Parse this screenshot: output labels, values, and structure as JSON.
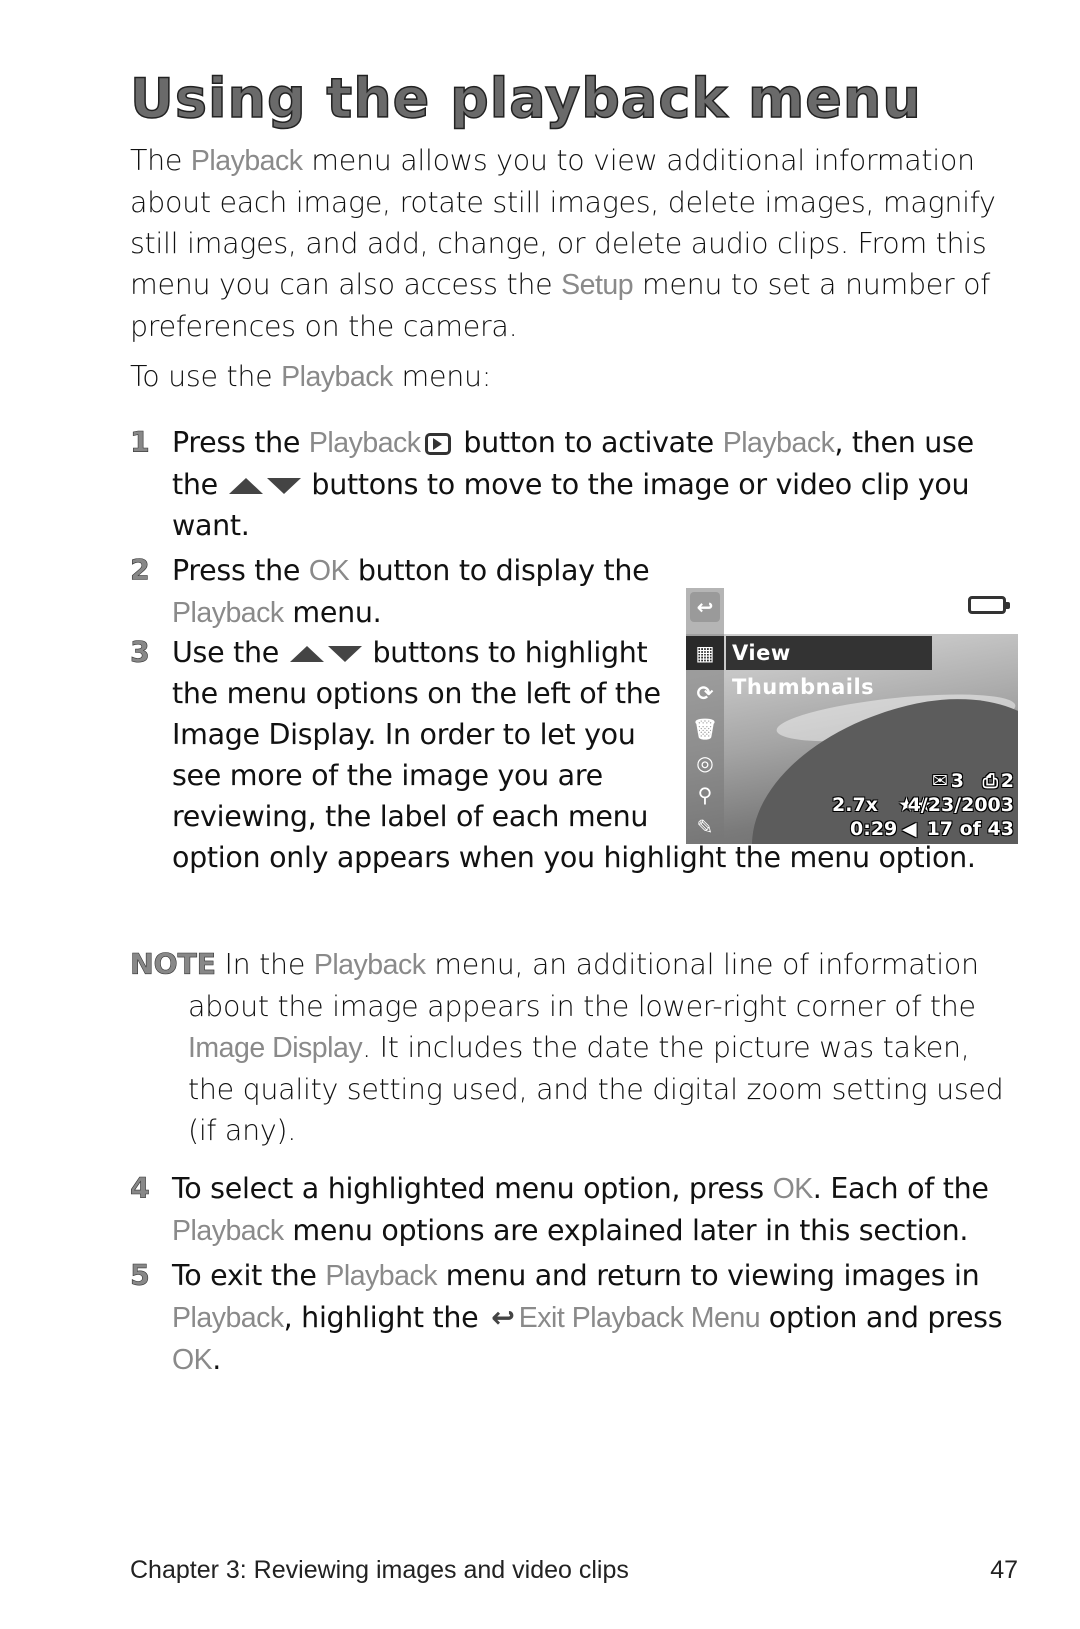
{
  "title": "Using the playback menu",
  "intro": {
    "part1": "The ",
    "term1": "Playback",
    "part2": " menu allows you to view additional information about each image, rotate still images, delete images, magnify still images, and add, change, or delete audio clips. From this menu you can also access the ",
    "term2": "Setup",
    "part3": " menu to set a number of preferences on the camera."
  },
  "lead_in": {
    "part1": "To use the ",
    "term": "Playback",
    "part2": " menu:"
  },
  "steps": [
    {
      "number": "1",
      "a": "Press the ",
      "term_a": "Playback",
      "b": " button to activate ",
      "term_b": "Playback",
      "c": ", then use the ",
      "d": " buttons to move to the image or video clip you want."
    },
    {
      "number": "2",
      "a": "Press the ",
      "term_a": "OK",
      "b": " button to display the ",
      "term_b": "Playback",
      "c": " menu."
    },
    {
      "number": "3",
      "a": "Use the ",
      "b": " buttons to highlight the menu options on the left of the Image Display. In order to let you see more of the image you are reviewing, the label of each menu option only appears when you highlight the menu option."
    },
    {
      "number": "4",
      "a": "To select a highlighted menu option, press ",
      "term_a": "OK",
      "b": ". Each of the ",
      "term_b": "Playback",
      "c": " menu options are explained later in this section."
    },
    {
      "number": "5",
      "a": "To exit the ",
      "term_a": "Playback",
      "b": " menu and return to viewing images in ",
      "term_b": "Playback",
      "c": ", highlight the ",
      "term_c": "Exit Playback Menu",
      "d": " option and press ",
      "term_d": "OK",
      "e": "."
    }
  ],
  "note": {
    "label": "NOTE",
    "a": " In the ",
    "term_a": "Playback",
    "b": " menu, an additional line of information about the image appears in the lower-right corner of the ",
    "term_b": "Image Display",
    "c": ". It includes the date the picture was taken, the quality setting used, and the digital zoom setting used (if any)."
  },
  "camera_display": {
    "highlighted_option": "View Thumbnails",
    "menu_icons": [
      "exit-icon",
      "thumbnails-icon",
      "rotate-icon",
      "delete-icon",
      "audio-icon",
      "magnify-icon",
      "setup-icon"
    ],
    "email_count": "3",
    "print_count": "2",
    "zoom": "2.7x",
    "quality": "★★",
    "date": "4/23/2003",
    "audio_length": "0:29",
    "image_index": "17 of 43"
  },
  "footer": {
    "chapter": "Chapter 3: Reviewing images and video clips",
    "page": "47"
  }
}
